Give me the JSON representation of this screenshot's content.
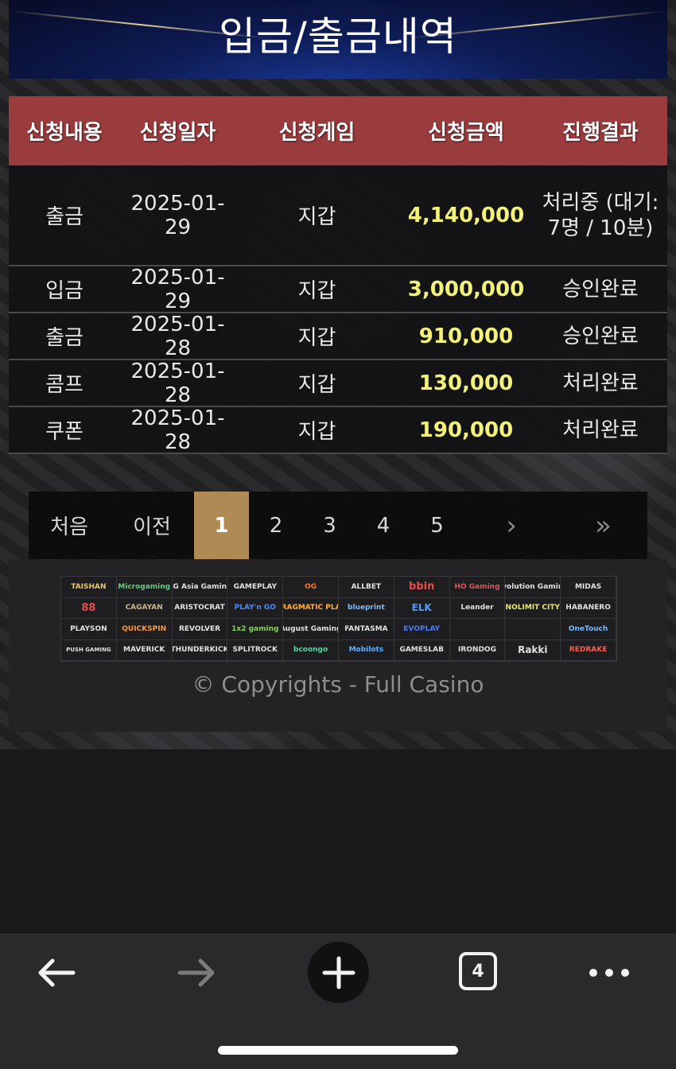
{
  "header": {
    "title": "입금/출금내역"
  },
  "table": {
    "headers": [
      "신청내용",
      "신청일자",
      "신청게임",
      "신청금액",
      "진행결과"
    ],
    "rows": [
      {
        "type": "출금",
        "date": "2025-01-29",
        "game": "지갑",
        "amount": "4,140,000",
        "result": "처리중 (대기: 7명 / 10분)"
      },
      {
        "type": "입금",
        "date": "2025-01-29",
        "game": "지갑",
        "amount": "3,000,000",
        "result": "승인완료"
      },
      {
        "type": "출금",
        "date": "2025-01-28",
        "game": "지갑",
        "amount": "910,000",
        "result": "승인완료"
      },
      {
        "type": "콤프",
        "date": "2025-01-28",
        "game": "지갑",
        "amount": "130,000",
        "result": "처리완료"
      },
      {
        "type": "쿠폰",
        "date": "2025-01-28",
        "game": "지갑",
        "amount": "190,000",
        "result": "처리완료"
      }
    ]
  },
  "pagination": {
    "first": "처음",
    "prev": "이전",
    "pages": [
      "1",
      "2",
      "3",
      "4",
      "5"
    ],
    "current": "1",
    "next": "›",
    "last": "»"
  },
  "footer": {
    "providers": [
      "TAISHAN",
      "Microgaming",
      "AG Asia Gaming",
      "GAMEPLAY",
      "OG",
      "ALLBET",
      "bbin",
      "HO Gaming",
      "Evolution Gaming",
      "MIDAS",
      "88",
      "CAGAYAN",
      "ARISTOCRAT",
      "PLAY'n GO",
      "PRAGMATIC PLAY",
      "blueprint",
      "ELK",
      "Leander",
      "NOLIMIT CITY",
      "HABANERO",
      "PLAYSON",
      "QUICKSPIN",
      "REVOLVER",
      "1x2 gaming",
      "August Gaming",
      "FANTASMA",
      "EVOPLAY",
      "",
      "",
      "OneTouch",
      "PUSH GAMING",
      "MAVERICK",
      "THUNDERKICK",
      "SPLITROCK",
      "bcoongo",
      "Mobilots",
      "GAMESLAB",
      "IRONDOG",
      "Rakki",
      "REDRAKE"
    ],
    "copyright": "© Copyrights - Full Casino"
  },
  "browser": {
    "tab_count": "4"
  },
  "colors": {
    "header_bg": "#9a3b3e",
    "amount": "#f2f27a",
    "active_page": "#b08a55"
  }
}
